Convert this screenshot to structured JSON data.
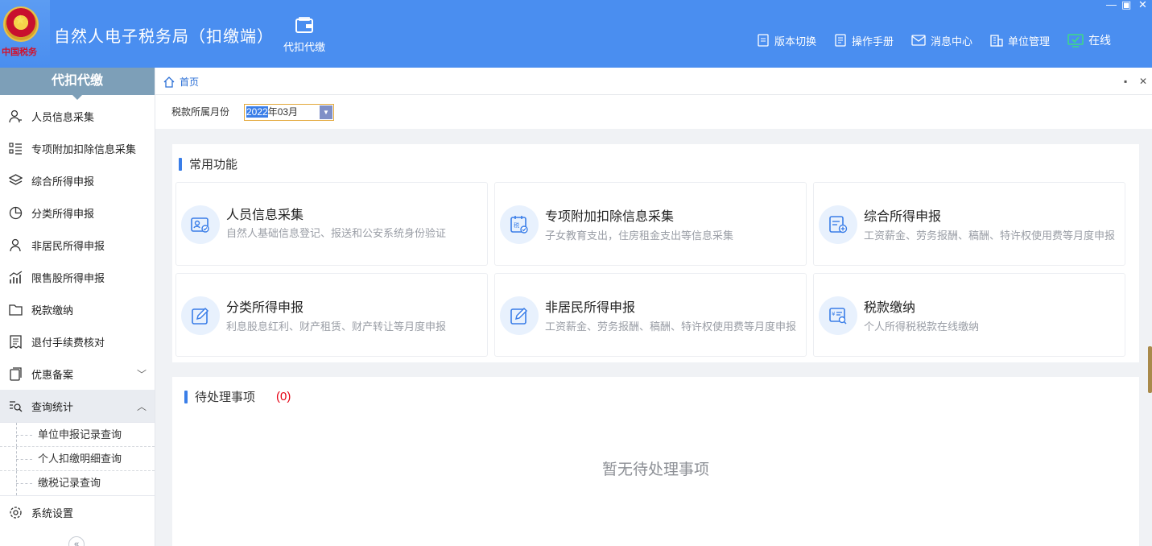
{
  "header": {
    "app_title": "自然人电子税务局（扣缴端）",
    "top_tab": "代扣代缴",
    "links": [
      {
        "label": "版本切换",
        "icon": "document-icon"
      },
      {
        "label": "操作手册",
        "icon": "manual-icon"
      },
      {
        "label": "消息中心",
        "icon": "mail-icon"
      },
      {
        "label": "单位管理",
        "icon": "building-icon"
      }
    ],
    "status": "在线",
    "logo_text": "中国税务",
    "colors": {
      "brand": "#4a8ef0",
      "accent": "#3a7ee8",
      "alert": "#e60012"
    }
  },
  "sidebar": {
    "title": "代扣代缴",
    "items": [
      {
        "label": "人员信息采集",
        "icon": "person-icon"
      },
      {
        "label": "专项附加扣除信息采集",
        "icon": "list-icon"
      },
      {
        "label": "综合所得申报",
        "icon": "layers-icon"
      },
      {
        "label": "分类所得申报",
        "icon": "pie-icon"
      },
      {
        "label": "非居民所得申报",
        "icon": "person-outline-icon"
      },
      {
        "label": "限售股所得申报",
        "icon": "bar-chart-icon"
      },
      {
        "label": "税款缴纳",
        "icon": "folder-icon"
      },
      {
        "label": "退付手续费核对",
        "icon": "receipt-icon"
      },
      {
        "label": "优惠备案",
        "icon": "copy-icon"
      },
      {
        "label": "查询统计",
        "icon": "search-list-icon"
      }
    ],
    "sub_items": [
      "单位申报记录查询",
      "个人扣缴明细查询",
      "缴税记录查询"
    ],
    "settings": "系统设置"
  },
  "breadcrumb": {
    "home": "首页"
  },
  "filter": {
    "label": "税款所属月份",
    "year": "2022",
    "rest": "年03月"
  },
  "common": {
    "title": "常用功能",
    "cards": [
      {
        "title": "人员信息采集",
        "desc": "自然人基础信息登记、报送和公安系统身份验证",
        "icon": "id-card-icon"
      },
      {
        "title": "专项附加扣除信息采集",
        "desc": "子女教育支出，住房租金支出等信息采集",
        "icon": "tax-calendar-icon"
      },
      {
        "title": "综合所得申报",
        "desc": "工资薪金、劳务报酬、稿酬、特许权使用费等月度申报",
        "icon": "doc-add-icon"
      },
      {
        "title": "分类所得申报",
        "desc": "利息股息红利、财产租赁、财产转让等月度申报",
        "icon": "edit-icon"
      },
      {
        "title": "非居民所得申报",
        "desc": "工资薪金、劳务报酬、稿酬、特许权使用费等月度申报",
        "icon": "edit-icon"
      },
      {
        "title": "税款缴纳",
        "desc": "个人所得税税款在线缴纳",
        "icon": "tax-search-icon"
      }
    ]
  },
  "pending": {
    "title": "待处理事项",
    "count": "(0)",
    "empty": "暂无待处理事项"
  }
}
